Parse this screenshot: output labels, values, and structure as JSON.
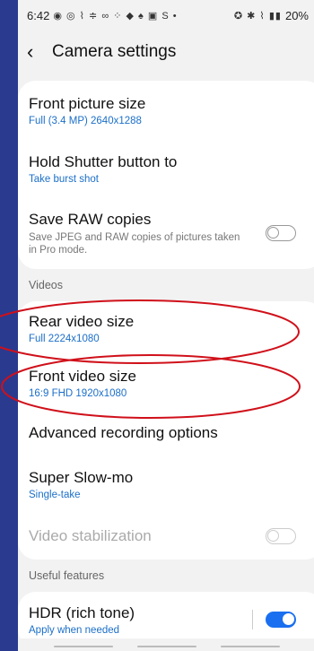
{
  "status_bar": {
    "time": "6:42",
    "left_icons": "◉ ◎ ⌇ ≑ ∞ ⁘ ◆ ♠ ▣ S •",
    "right_icons": "✪ ✱ ⌇ ▮▮",
    "battery": "20%"
  },
  "app_bar": {
    "title": "Camera settings"
  },
  "picture": {
    "front_size_label": "Front picture size",
    "front_size_value": "Full (3.4 MP) 2640x1288",
    "hold_shutter_label": "Hold Shutter button to",
    "hold_shutter_value": "Take burst shot",
    "raw_label": "Save RAW copies",
    "raw_desc": "Save JPEG and RAW copies of pictures taken in Pro mode."
  },
  "videos": {
    "header": "Videos",
    "rear_label": "Rear video size",
    "rear_value": "Full 2224x1080",
    "front_label": "Front video size",
    "front_value": "16:9 FHD 1920x1080",
    "advanced_label": "Advanced recording options",
    "slowmo_label": "Super Slow-mo",
    "slowmo_value": "Single-take",
    "stabilization_label": "Video stabilization"
  },
  "useful": {
    "header": "Useful features",
    "hdr_label": "HDR (rich tone)",
    "hdr_value": "Apply when needed"
  },
  "colors": {
    "accent": "#1b6fc9",
    "annotation": "#d0101a",
    "background": "#2a3a8f"
  }
}
